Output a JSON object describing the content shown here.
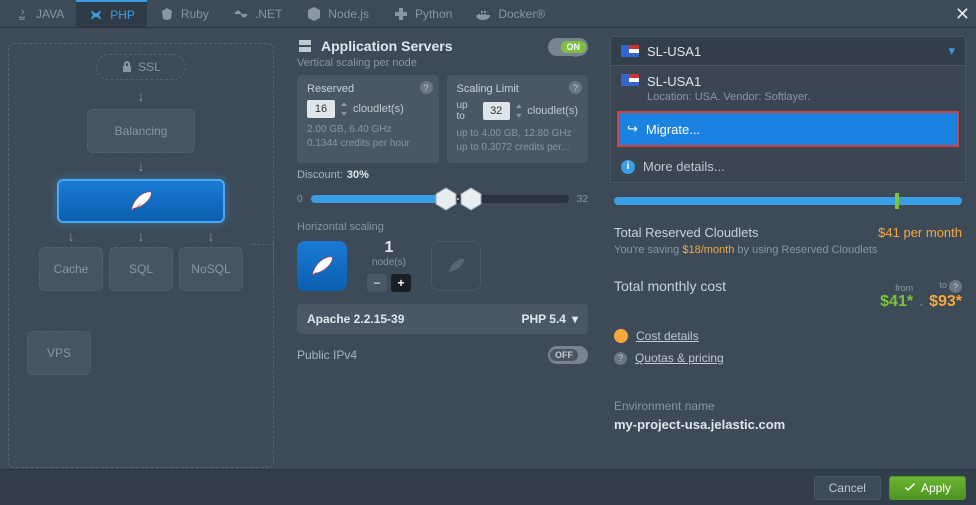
{
  "tabs": {
    "java": "JAVA",
    "php": "PHP",
    "ruby": "Ruby",
    "net": ".NET",
    "node": "Node.js",
    "python": "Python",
    "docker": "Docker®"
  },
  "topology": {
    "ssl": "SSL",
    "balancing": "Balancing",
    "cache": "Cache",
    "sql": "SQL",
    "nosql": "NoSQL",
    "vps": "VPS"
  },
  "appServers": {
    "title": "Application Servers",
    "toggle": "ON",
    "vertLabel": "Vertical scaling per node",
    "reserved": {
      "title": "Reserved",
      "value": "16",
      "unit": "cloudlet(s)",
      "stat1": "2.00 GB, 6.40 GHz",
      "stat2": "0.1344 credits per hour"
    },
    "scalingLimit": {
      "title": "Scaling Limit",
      "prefix": "up to",
      "value": "32",
      "unit": "cloudlet(s)",
      "stat1": "up to 4.00 GB, 12.80 GHz",
      "stat2": "up to 0.3072 credits per..."
    },
    "discountLabel": "Discount:",
    "discountValue": "30%",
    "sliderMin": "0",
    "sliderMax": "32",
    "horizLabel": "Horizontal scaling",
    "nodeCount": "1",
    "nodeLabel": "node(s)",
    "server": "Apache 2.2.15-39",
    "phpVer": "PHP 5.4",
    "ipv4": "Public IPv4",
    "ipv4Toggle": "OFF"
  },
  "region": {
    "selected": "SL-USA1",
    "itemName": "SL-USA1",
    "itemLoc": "Location: USA. Vendor: Softlayer.",
    "migrate": "Migrate...",
    "moreDetails": "More details..."
  },
  "pricing": {
    "reservedLabel": "Total Reserved Cloudlets",
    "reservedPrice": "$41 per month",
    "savingPrefix": "You're saving ",
    "savingAmount": "$18/month",
    "savingSuffix": " by using Reserved Cloudlets",
    "totalLabel": "Total monthly cost",
    "from": "from",
    "to": "to",
    "fromPrice": "$41*",
    "toPrice": "$93*",
    "costDetails": "Cost details",
    "quotas": "Quotas & pricing"
  },
  "environment": {
    "label": "Environment name",
    "value": "my-project-usa.jelastic.com"
  },
  "footer": {
    "cancel": "Cancel",
    "apply": "Apply"
  }
}
